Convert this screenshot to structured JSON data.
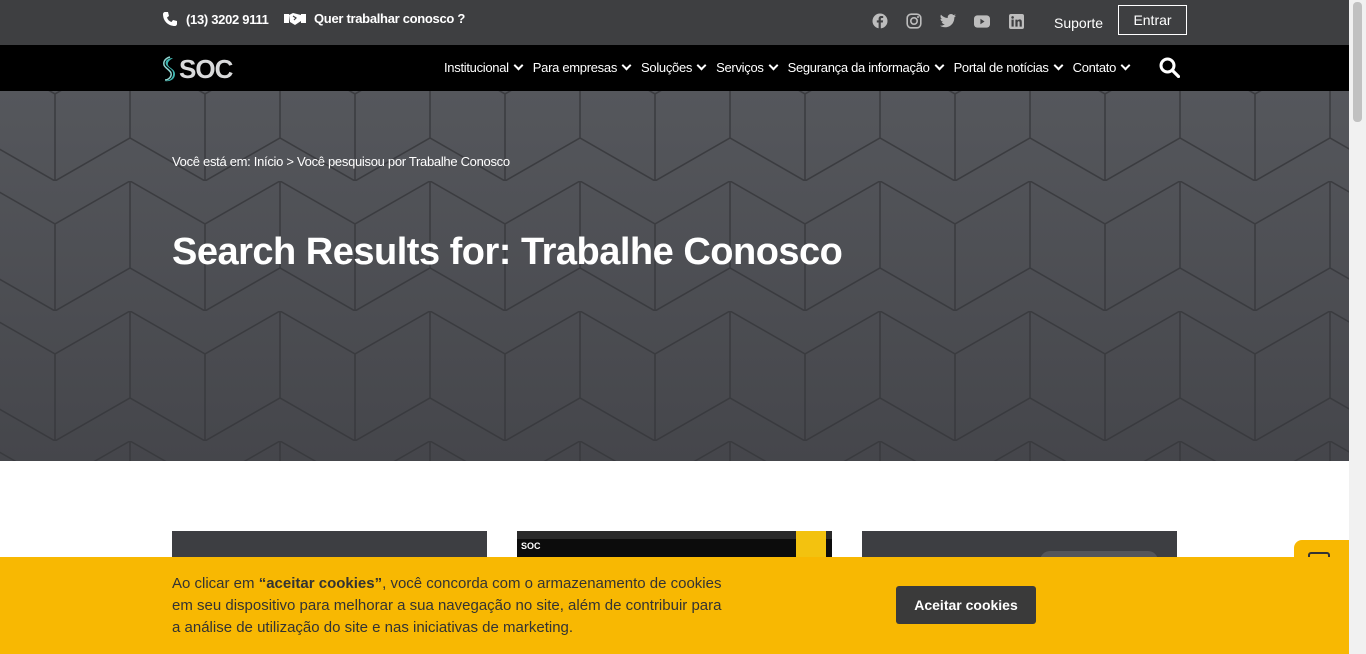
{
  "topbar": {
    "phone": "(13) 3202 9111",
    "work_link": "Quer trabalhar conosco ?",
    "socials": [
      "facebook-icon",
      "instagram-icon",
      "twitter-icon",
      "youtube-icon",
      "linkedin-icon"
    ],
    "support": "Suporte",
    "login": "Entrar"
  },
  "nav": {
    "logo": "SOC",
    "items": [
      {
        "label": "Institucional"
      },
      {
        "label": "Para empresas"
      },
      {
        "label": "Soluções"
      },
      {
        "label": "Serviços"
      },
      {
        "label": "Segurança da informação"
      },
      {
        "label": "Portal de notícias"
      },
      {
        "label": "Contato"
      }
    ]
  },
  "hero": {
    "breadcrumb": "Você está em: Início > Você pesquisou por Trabalhe Conosco",
    "title": "Search Results for: Trabalhe Conosco"
  },
  "card2_preview": {
    "logo": "SOC"
  },
  "cookie": {
    "text_before": "Ao clicar em ",
    "text_bold": "“aceitar cookies”",
    "text_after": ", você concorda com o armazenamento de cookies em seu dispositivo para melhorar a sua navegação no site, além de contribuir para a análise de utilização do site e nas iniciativas de marketing.",
    "accept": "Aceitar cookies"
  },
  "colors": {
    "topbar": "#3e3f41",
    "nav": "#000000",
    "cookie": "#f8b802",
    "button": "#3a3a3a"
  }
}
